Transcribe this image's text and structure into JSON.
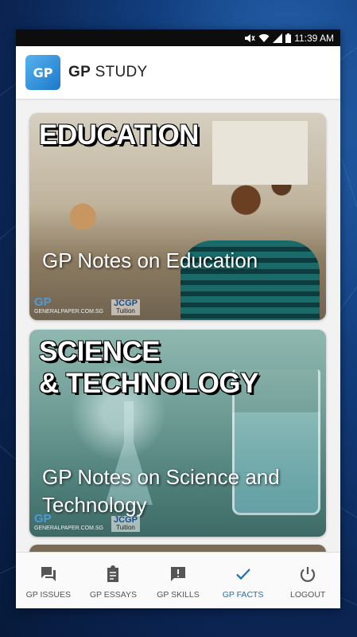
{
  "status_bar": {
    "time": "11:39 AM"
  },
  "app": {
    "title_bold": "GP",
    "title_rest": " STUDY",
    "logo_text": "GP"
  },
  "cards": [
    {
      "heading": "EDUCATION",
      "subtitle": "GP Notes on Education",
      "watermark_site": "GENERALPAPER.COM.SG",
      "watermark_brand": "JCGP",
      "watermark_tuition": "Tuition"
    },
    {
      "heading": "SCIENCE\n& TECHNOLOGY",
      "subtitle": "GP Notes on Science and Technology",
      "watermark_site": "GENERALPAPER.COM.SG",
      "watermark_brand": "JCGP",
      "watermark_tuition": "Tuition"
    }
  ],
  "bottom_nav": [
    {
      "label": "GP ISSUES",
      "icon": "chat-icon",
      "active": false
    },
    {
      "label": "GP ESSAYS",
      "icon": "clipboard-icon",
      "active": false
    },
    {
      "label": "GP SKILLS",
      "icon": "alert-message-icon",
      "active": false
    },
    {
      "label": "GP FACTS",
      "icon": "check-icon",
      "active": true
    },
    {
      "label": "LOGOUT",
      "icon": "power-icon",
      "active": false
    }
  ],
  "colors": {
    "accent": "#1d6fb5",
    "nav_inactive": "#555555"
  }
}
